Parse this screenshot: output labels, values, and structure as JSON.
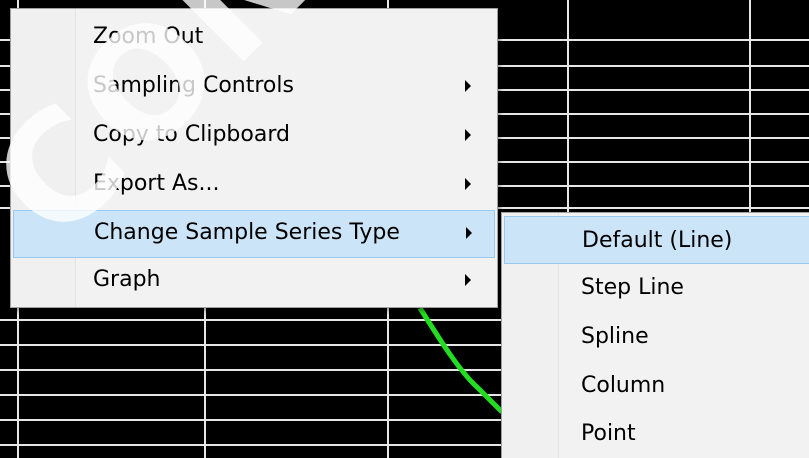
{
  "colors": {
    "chart_background": "#000000",
    "grid_line": "#ffffff",
    "series_line": "#22dd22",
    "menu_background": "#f2f2f2",
    "highlight": "#cce4f7",
    "highlight_border": "#99c9ef"
  },
  "context_menu": {
    "items": [
      {
        "label": "Zoom Out",
        "has_submenu": false
      },
      {
        "label": "Sampling Controls",
        "has_submenu": true
      },
      {
        "label": "Copy to Clipboard",
        "has_submenu": true
      },
      {
        "label": "Export As...",
        "has_submenu": true
      },
      {
        "label": "Change Sample Series Type",
        "has_submenu": true,
        "highlighted": true
      },
      {
        "label": "Graph",
        "has_submenu": true
      }
    ]
  },
  "submenu": {
    "items": [
      {
        "label": "Default (Line)",
        "highlighted": true
      },
      {
        "label": "Step Line"
      },
      {
        "label": "Spline"
      },
      {
        "label": "Column"
      },
      {
        "label": "Point"
      }
    ]
  },
  "watermark": {
    "text": "CONTIN"
  },
  "icons": {
    "submenu_arrow": "chevron-right-icon"
  }
}
